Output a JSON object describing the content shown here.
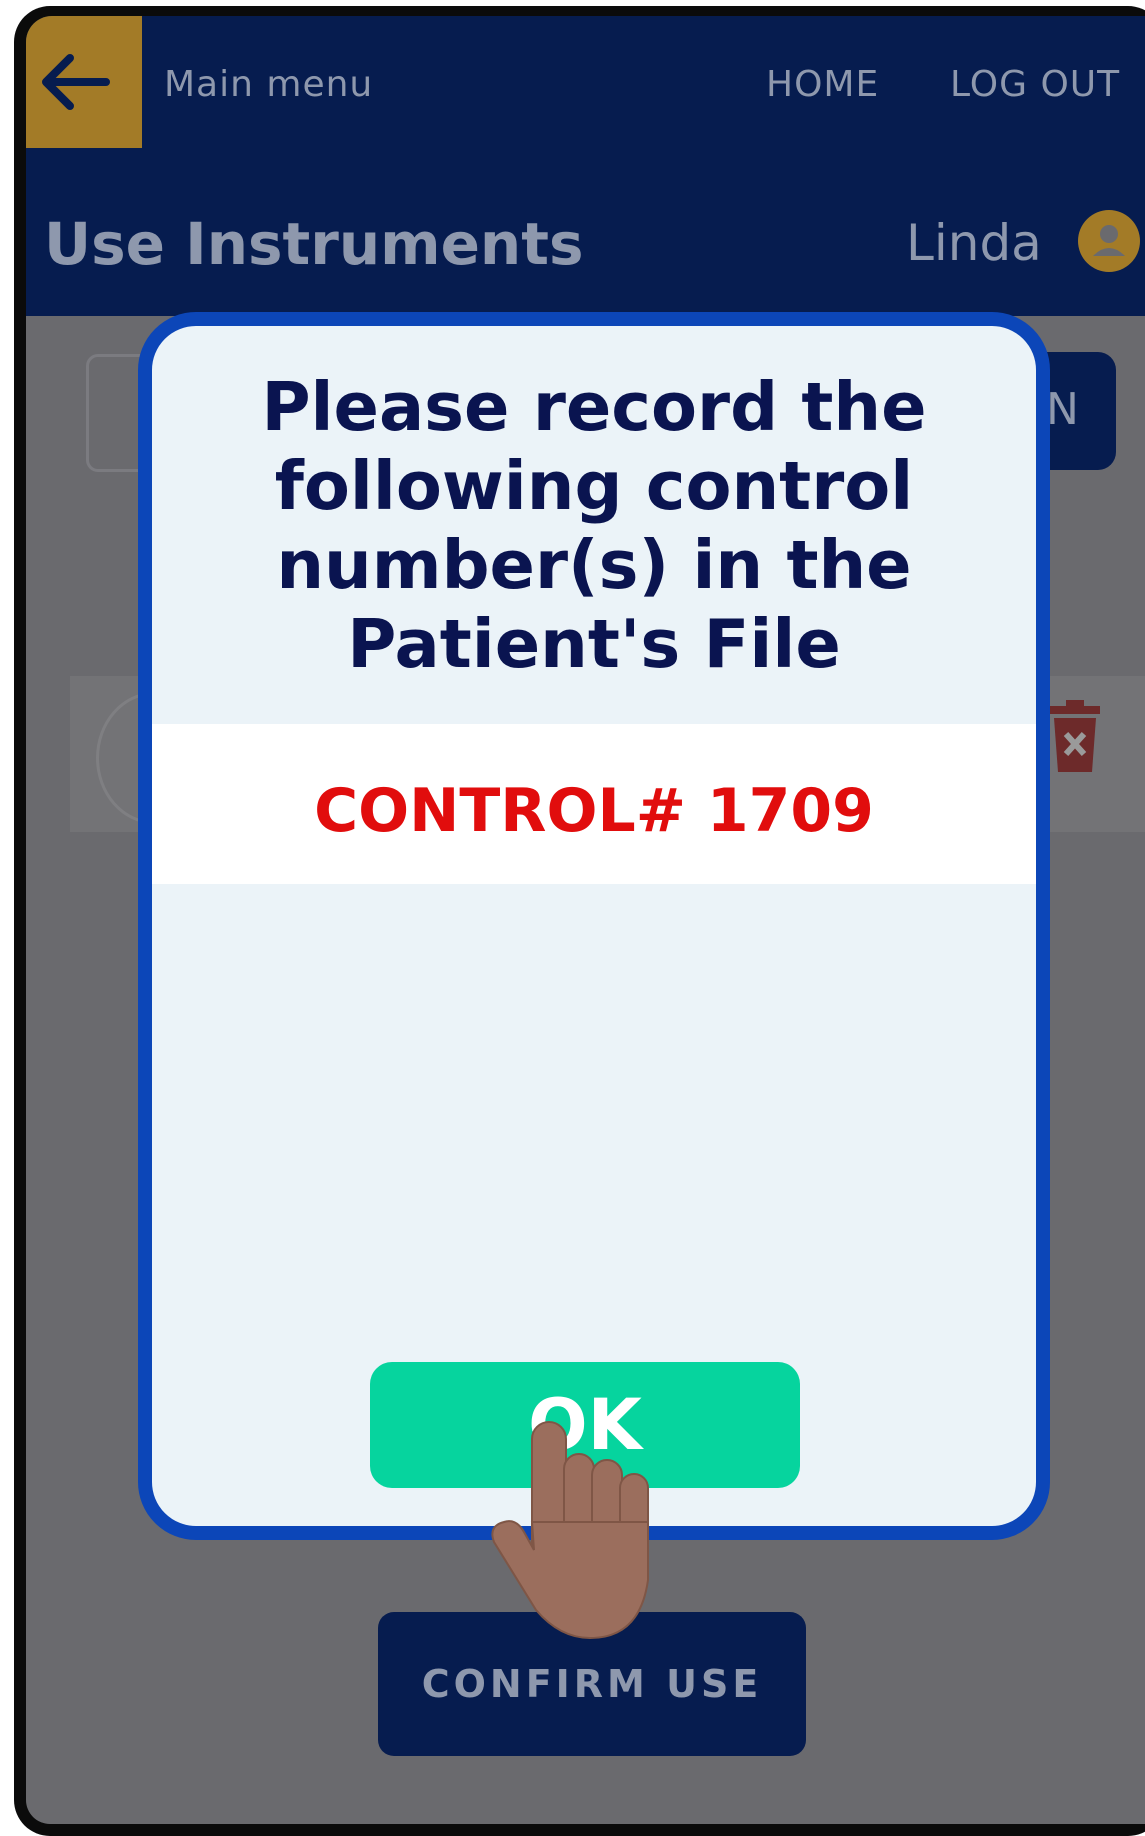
{
  "nav": {
    "back_icon": "arrow-left-icon",
    "main_menu": "Main menu",
    "home": "HOME",
    "logout": "LOG OUT"
  },
  "header": {
    "title": "Use Instruments",
    "user": "Linda",
    "avatar_icon": "user-avatar-icon"
  },
  "background": {
    "partial_button": "N",
    "confirm_label": "CONFIRM USE",
    "delete_icon": "trash-icon"
  },
  "modal": {
    "message": "Please record the following control number(s) in the Patient's File",
    "control_label": "CONTROL# 1709",
    "ok_label": "OK"
  },
  "colors": {
    "navy": "#061c4f",
    "accent_gold": "#a37b27",
    "modal_border": "#0c46b8",
    "ok_green": "#06d49e",
    "control_red": "#e10d0d"
  }
}
